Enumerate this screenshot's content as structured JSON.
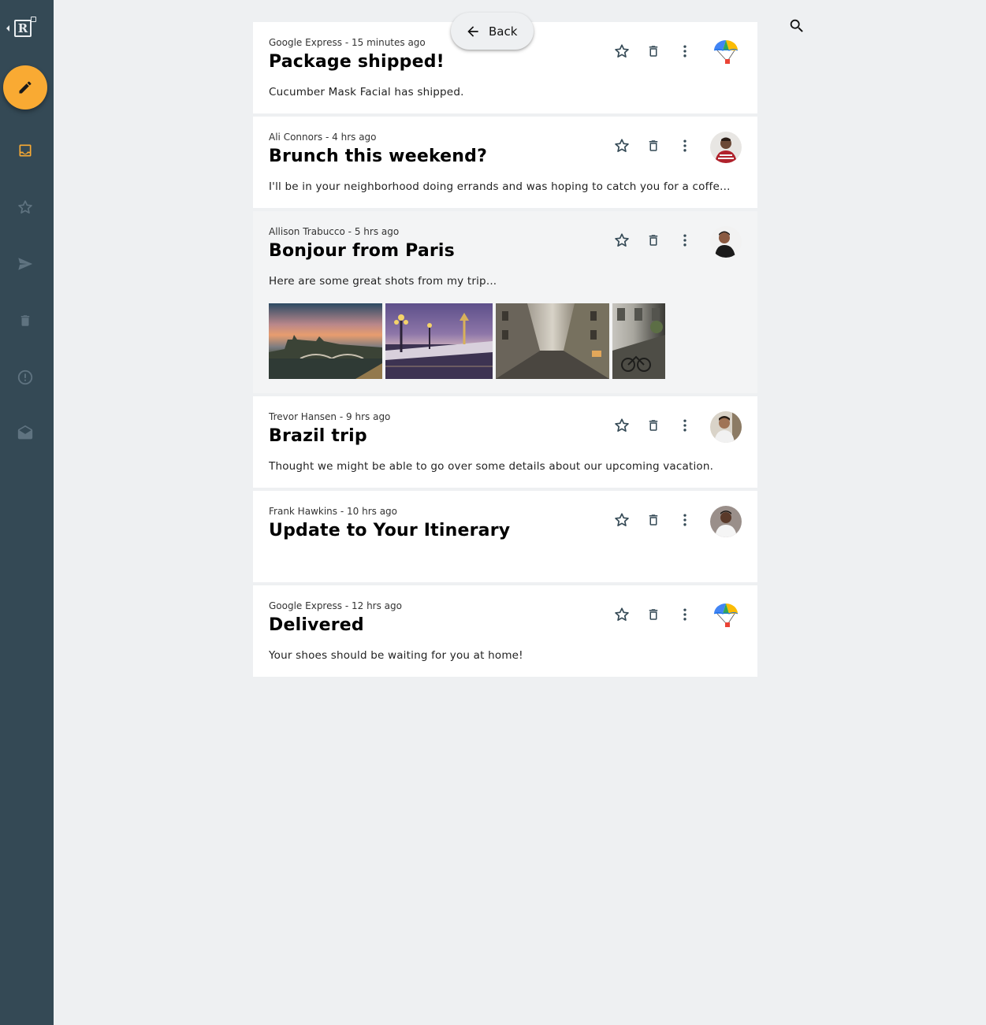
{
  "nav": {
    "items": [
      {
        "name": "inbox",
        "icon": "inbox-icon",
        "active": true
      },
      {
        "name": "starred",
        "icon": "star-outline-icon"
      },
      {
        "name": "sent",
        "icon": "send-icon"
      },
      {
        "name": "trash",
        "icon": "trash-icon"
      },
      {
        "name": "spam",
        "icon": "alert-circle-icon"
      },
      {
        "name": "drafts",
        "icon": "drafts-icon"
      }
    ],
    "compose_icon": "edit-icon",
    "logo_letter": "R"
  },
  "header": {
    "back_label": "Back",
    "search_icon": "search-icon"
  },
  "emails": [
    {
      "sender": "Google Express",
      "time": "15 minutes ago",
      "subject": "Package shipped!",
      "preview": "Cucumber Mask Facial has shipped.",
      "avatar": "google-express"
    },
    {
      "sender": "Ali Connors",
      "time": "4 hrs ago",
      "subject": "Brunch this weekend?",
      "preview": "I'll be in your neighborhood doing errands and was hoping to catch you for a coffee and a bagel",
      "avatar": "person"
    },
    {
      "sender": "Allison Trabucco",
      "time": "5 hrs ago",
      "subject": "Bonjour from Paris",
      "preview": "Here are some great shots from my trip...",
      "avatar": "person",
      "photos": 4
    },
    {
      "sender": "Trevor Hansen",
      "time": "9 hrs ago",
      "subject": "Brazil trip",
      "preview": "Thought we might be able to go over some details about our upcoming vacation.",
      "avatar": "person"
    },
    {
      "sender": "Frank Hawkins",
      "time": "10 hrs ago",
      "subject": "Update to Your Itinerary",
      "preview": "",
      "avatar": "person"
    },
    {
      "sender": "Google Express",
      "time": "12 hrs ago",
      "subject": "Delivered",
      "preview": "Your shoes should be waiting for you at home!",
      "avatar": "google-express"
    }
  ],
  "colors": {
    "rail": "#344955",
    "accent": "#f9aa33",
    "background": "#eef0f2",
    "icon": "#344955"
  }
}
